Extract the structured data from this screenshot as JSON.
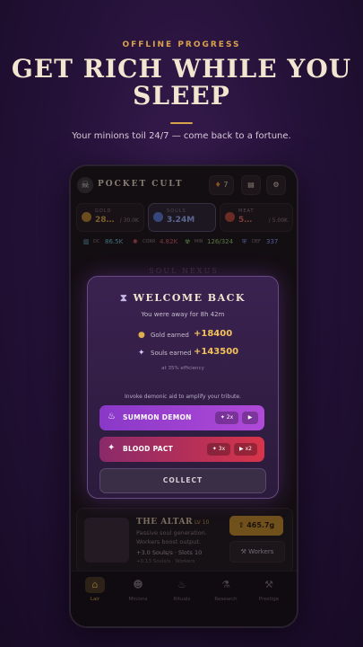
{
  "promo": {
    "kicker": "OFFLINE PROGRESS",
    "headline": "GET RICH WHILE YOU SLEEP",
    "subline": "Your minions toil 24/7 — come back to a fortune."
  },
  "app": {
    "brand": "POCKET CULT",
    "gem_count": "7",
    "resources": [
      {
        "label": "GOLD",
        "value": "28…",
        "cap": "/ 30.0K",
        "color": "#d6a444"
      },
      {
        "label": "SOULS",
        "value": "3.24M",
        "cap": "",
        "color": "#9fb4ff"
      },
      {
        "label": "MEAT",
        "value": "5…",
        "cap": "/ 5.00K",
        "color": "#d96a5a"
      }
    ],
    "stats": [
      {
        "icon": "book",
        "label": "DC",
        "value": "86.5K",
        "color": "#6fc3d8"
      },
      {
        "icon": "cog",
        "label": "CORR",
        "value": "4.82K",
        "color": "#e05a6a"
      },
      {
        "icon": "nuke",
        "label": "MIN",
        "value": "126/324",
        "color": "#8fd26a"
      },
      {
        "icon": "shield",
        "label": "DEF",
        "value": "337",
        "color": "#8aa0ff"
      }
    ],
    "section": "SOUL NEXUS",
    "altar": {
      "title": "THE ALTAR",
      "level": "LV 10",
      "desc1": "Passive soul generation.",
      "desc2": "Workers boost output.",
      "rate": "+3.0 Souls/s · Slots 10",
      "sub": "+0.13 Souls/s · Workers",
      "price": "465.7g",
      "workers_label": "Workers"
    },
    "nav": [
      {
        "label": "Lair",
        "active": true
      },
      {
        "label": "Minions",
        "active": false
      },
      {
        "label": "Rituals",
        "active": false
      },
      {
        "label": "Research",
        "active": false
      },
      {
        "label": "Prestige",
        "active": false
      }
    ]
  },
  "modal": {
    "title": "WELCOME BACK",
    "away": "You were away for 8h 42m",
    "gold_label": "Gold earned",
    "gold_value": "+18400",
    "souls_label": "Souls earned",
    "souls_value": "+143500",
    "efficiency": "at 35% efficiency",
    "invoke": "Invoke demonic aid to amplify your tribute.",
    "summon_label": "SUMMON DEMON",
    "summon_mult": "2x",
    "pact_label": "BLOOD PACT",
    "pact_mult": "3x",
    "pact_video": "x2",
    "collect_label": "COLLECT"
  }
}
